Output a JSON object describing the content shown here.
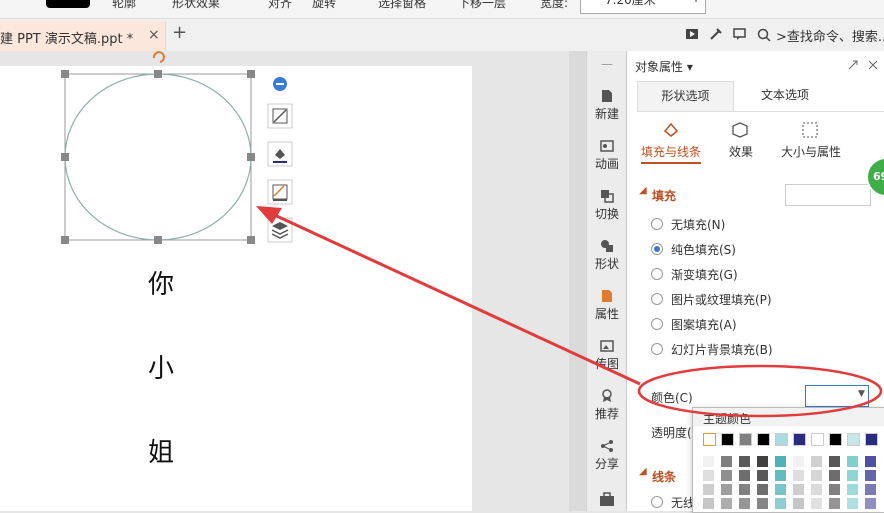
{
  "toolbar": {
    "outline_label": "轮廓",
    "shape_effect_label": "形状效果",
    "align_label": "对齐",
    "rotate_label": "旋转",
    "select_pane_label": "选择窗格",
    "send_back_label": "下移一层",
    "width_label": "宽度:",
    "width_value": "7.20厘米",
    "minus": "−",
    "plus": "+"
  },
  "tabbar": {
    "doc_tab_label": "建 PPT 演示文稿.ppt *",
    "close": "×",
    "add": "+",
    "search_text": ">查找命令、搜索..."
  },
  "slide": {
    "chars": [
      "你",
      "小",
      "姐"
    ]
  },
  "sidebar": {
    "items": [
      {
        "label": "新建",
        "icon": "new-doc-icon"
      },
      {
        "label": "动画",
        "icon": "animation-icon"
      },
      {
        "label": "切换",
        "icon": "transition-icon"
      },
      {
        "label": "形状",
        "icon": "shape-icon"
      },
      {
        "label": "属性",
        "icon": "property-icon"
      },
      {
        "label": "传图",
        "icon": "upload-image-icon"
      },
      {
        "label": "推荐",
        "icon": "recommend-icon"
      },
      {
        "label": "分享",
        "icon": "share-icon"
      }
    ]
  },
  "panel": {
    "title": "对象属性 ▾",
    "tabs": [
      "形状选项",
      "文本选项"
    ],
    "subtabs": [
      "填充与线条",
      "效果",
      "大小与属性"
    ],
    "fill_section": "填充",
    "fill_options": [
      "无填充(N)",
      "纯色填充(S)",
      "渐变填充(G)",
      "图片或纹理填充(P)",
      "图案填充(A)",
      "幻灯片背景填充(B)"
    ],
    "selected_fill": 1,
    "color_label": "颜色(C)",
    "transparency_label": "透明度(",
    "line_section": "线条",
    "no_line_label": "无线",
    "popup_title": "主题颜色",
    "badge": "69"
  },
  "colors": {
    "accent": "#c0501f",
    "arrow": "#e23b3b",
    "ellipse": "#e23b3b",
    "theme_row": [
      "#ffffff",
      "#000000",
      "#808080",
      "#000000",
      "#a9dbe0",
      "#2b2b80",
      "#ffffff",
      "#000000",
      "#c7e8e8",
      "#2b2b80"
    ]
  }
}
